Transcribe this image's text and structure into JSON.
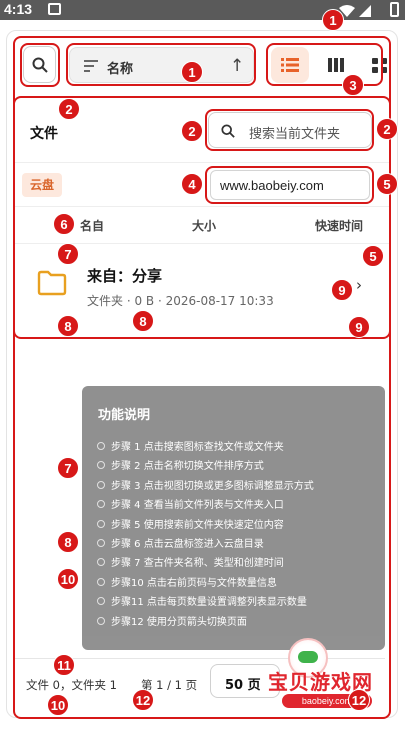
{
  "status_bar": {
    "time": "4:13"
  },
  "toolbar": {
    "sort_label": "名称",
    "sort_direction_icon": "arrow-up-icon",
    "view_modes": [
      "list-view-icon",
      "column-view-icon",
      "grid-view-icon"
    ],
    "active_view": "list",
    "accent_color": "#e8622a"
  },
  "panel": {
    "title": "文件",
    "folder_search_placeholder": "搜索当前文件夹",
    "tab_label": "云盘",
    "url_text": "www.baobeiy.com",
    "columns": [
      "名自",
      "大小",
      "快速时间"
    ]
  },
  "files": [
    {
      "name": "来自：分享",
      "meta": "文件夹 · 0 B · 2026-08-17 10:33",
      "icon": "folder-icon"
    }
  ],
  "help": {
    "title": "功能说明",
    "steps": [
      "步骤 1 点击搜索图标查找文件或文件夹",
      "步骤 2 点击名称切换文件排序方式",
      "步骤 3 点击视图切换或更多图标调整显示方式",
      "步骤 4 查看当前文件列表与文件夹入口",
      "步骤 5 使用搜索前文件夹快速定位内容",
      "步骤 6 点击云盘标签进入云盘目录",
      "步骤 7 查古件夹名称、类型和创建时间",
      "步骤10 点击右前页码与文件数量信息",
      "步骤11 点击每页数量设置调整列表显示数量",
      "步骤12 使用分页箭头切换页面"
    ]
  },
  "footer": {
    "count_text": "文件 0，文件夹 1",
    "page_text": "第 1 / 1 页",
    "page_size": "50 页"
  },
  "watermark": {
    "title": "宝贝游戏网",
    "url": "baobeiy.com"
  },
  "annotations": [
    "1",
    "1",
    "1",
    "2",
    "2",
    "2",
    "2",
    "3",
    "4",
    "5",
    "5",
    "6",
    "7",
    "7",
    "8",
    "8",
    "8",
    "9",
    "9",
    "10",
    "10",
    "11",
    "12",
    "12"
  ]
}
